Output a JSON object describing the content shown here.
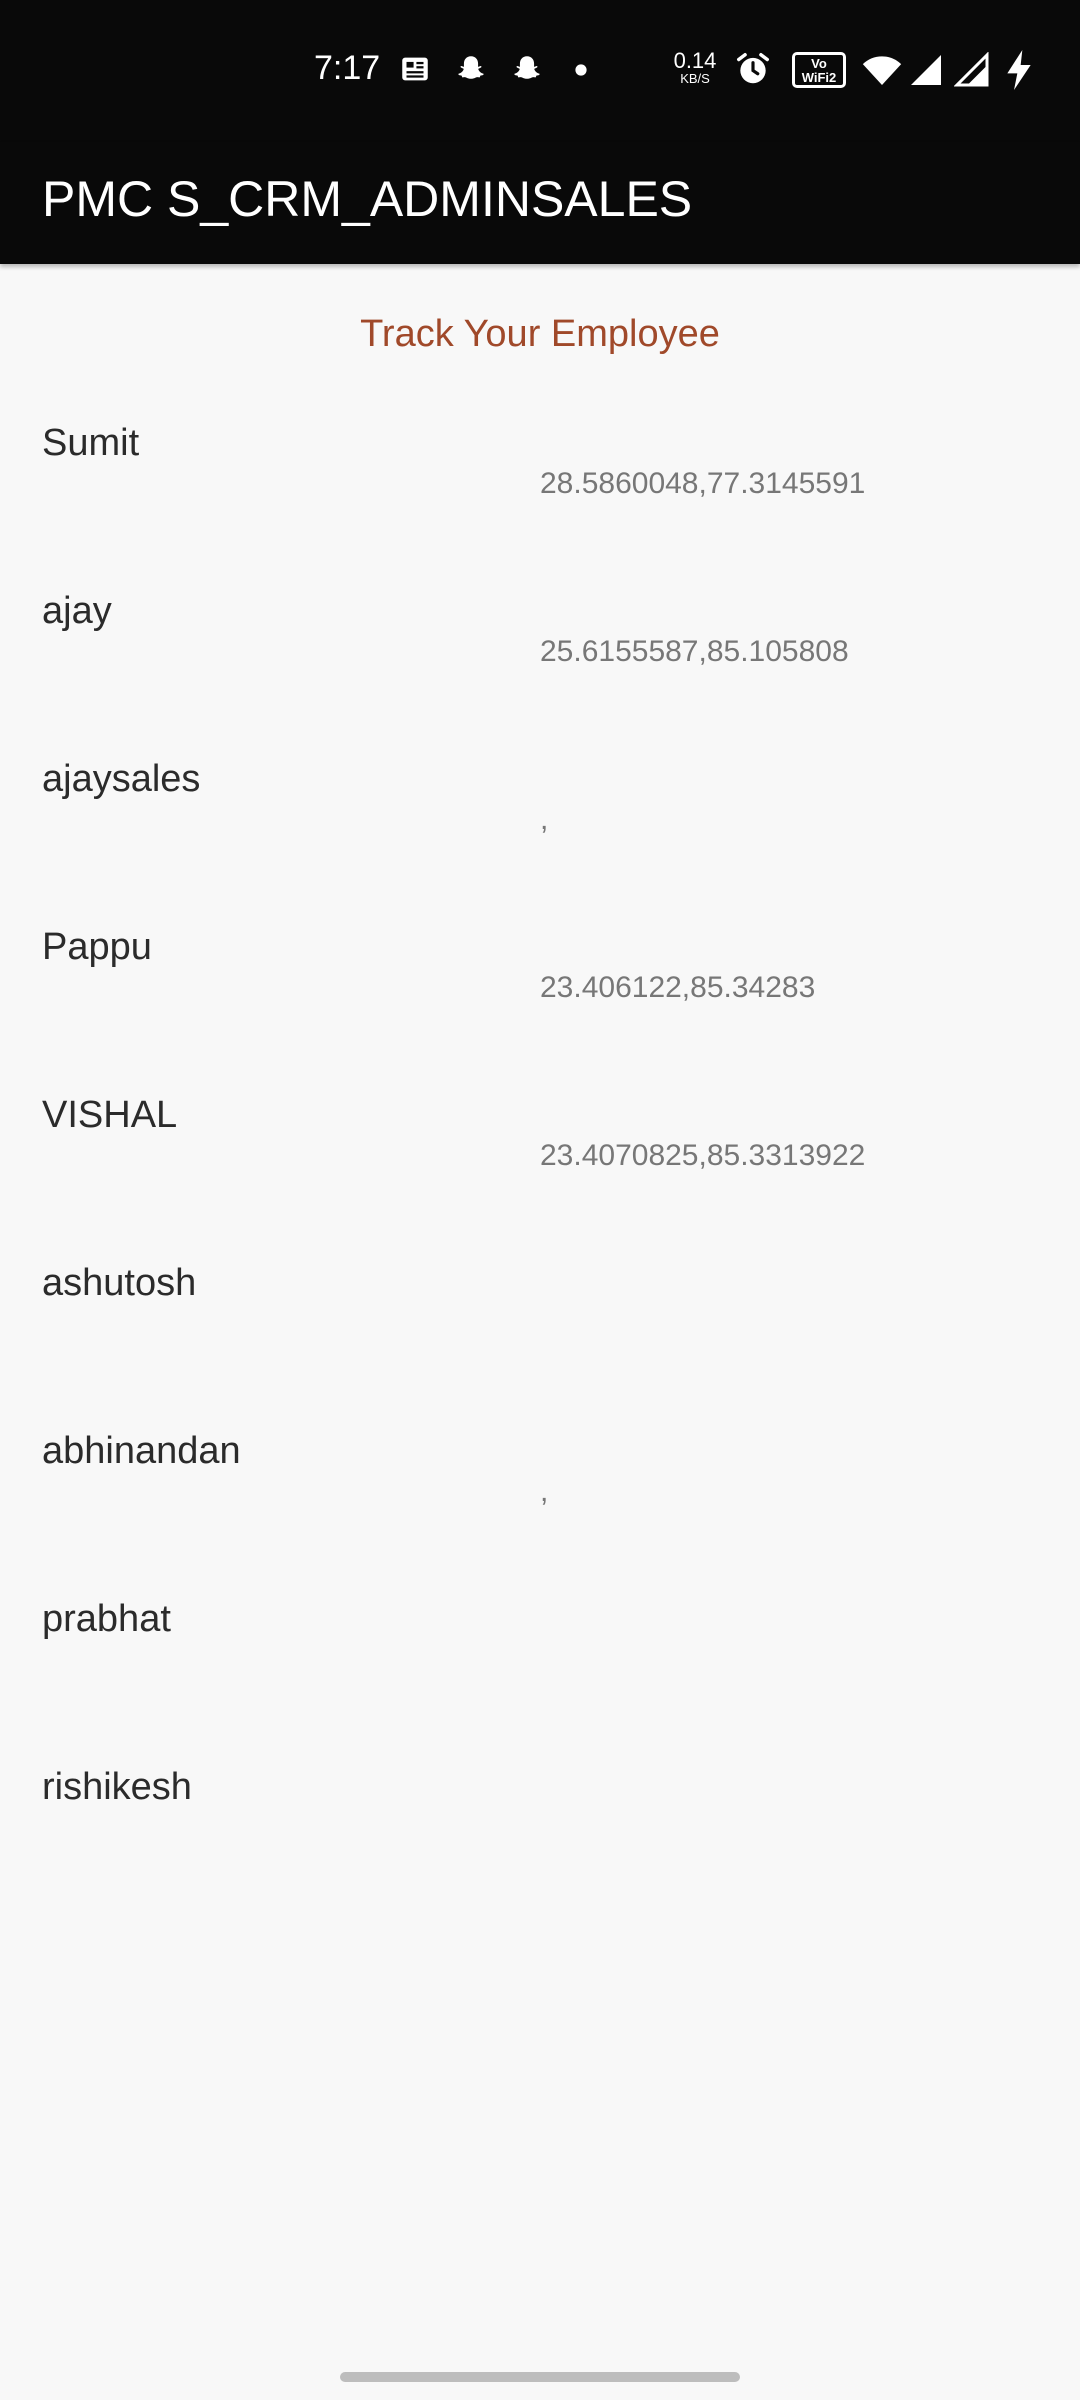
{
  "status_bar": {
    "time": "7:17",
    "net_speed_value": "0.14",
    "net_speed_unit": "KB/S",
    "vowifi_line1": "Vo",
    "vowifi_line2": "WiFi2",
    "icons": [
      "news-icon",
      "snapchat-icon",
      "snapchat-icon",
      "dot-icon",
      "alarm-icon",
      "vowifi-icon",
      "wifi-icon",
      "signal-icon",
      "signal-icon",
      "charging-icon"
    ]
  },
  "app_bar": {
    "title": "PMC S_CRM_ADMINSALES"
  },
  "header": {
    "title": "Track Your Employee"
  },
  "employees": [
    {
      "name": "Sumit",
      "coords": "28.5860048,77.3145591"
    },
    {
      "name": "ajay",
      "coords": "25.6155587,85.105808"
    },
    {
      "name": "ajaysales",
      "coords": ","
    },
    {
      "name": "Pappu",
      "coords": "23.406122,85.34283"
    },
    {
      "name": "VISHAL",
      "coords": "23.4070825,85.3313922"
    },
    {
      "name": "ashutosh",
      "coords": ""
    },
    {
      "name": "abhinandan",
      "coords": ","
    },
    {
      "name": "prabhat",
      "coords": ""
    },
    {
      "name": "rishikesh",
      "coords": ""
    }
  ],
  "colors": {
    "app_bar_bg": "#090909",
    "page_bg": "#f8f8f8",
    "header_accent": "#a0492a",
    "name_text": "#2b2b2b",
    "coords_text": "#777777"
  }
}
